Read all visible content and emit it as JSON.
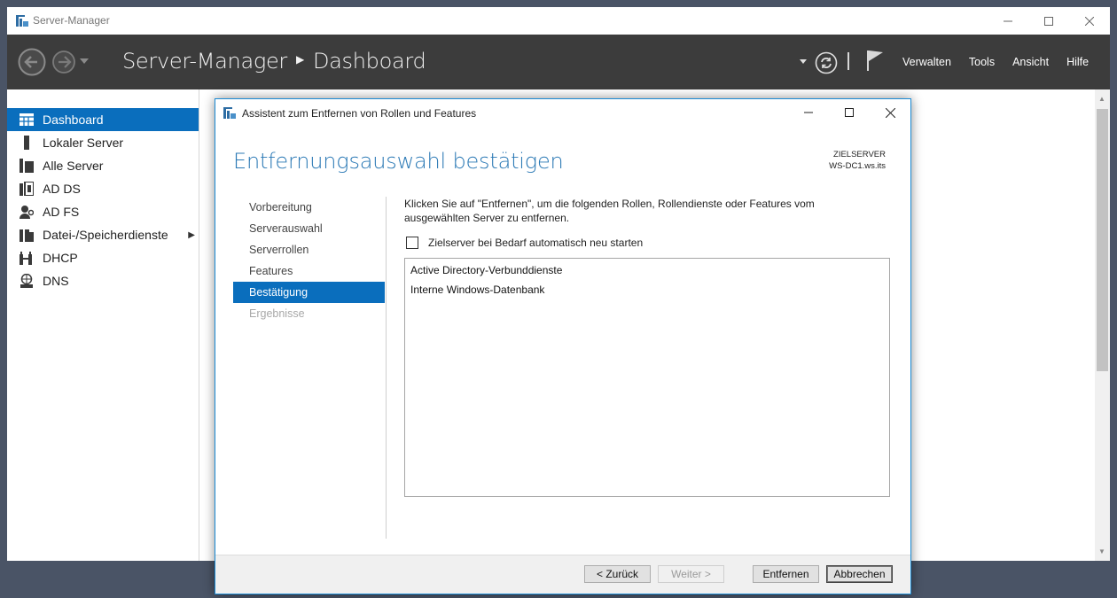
{
  "window": {
    "title": "Server-Manager",
    "controls": [
      "minimize-icon",
      "maximize-icon",
      "close-icon"
    ]
  },
  "header": {
    "breadcrumb_root": "Server-Manager",
    "breadcrumb_current": "Dashboard",
    "menus": [
      "Verwalten",
      "Tools",
      "Ansicht",
      "Hilfe"
    ]
  },
  "sidebar": {
    "items": [
      {
        "label": "Dashboard",
        "icon": "dashboard-icon",
        "active": true
      },
      {
        "label": "Lokaler Server",
        "icon": "server-icon"
      },
      {
        "label": "Alle Server",
        "icon": "servers-icon"
      },
      {
        "label": "AD DS",
        "icon": "ad-ds-icon"
      },
      {
        "label": "AD FS",
        "icon": "ad-fs-icon"
      },
      {
        "label": "Datei-/Speicherdienste",
        "icon": "storage-icon",
        "expandable": true
      },
      {
        "label": "DHCP",
        "icon": "dhcp-icon"
      },
      {
        "label": "DNS",
        "icon": "dns-icon"
      }
    ]
  },
  "dialog": {
    "title": "Assistent zum Entfernen von Rollen und Features",
    "heading": "Entfernungsauswahl bestätigen",
    "target_label": "ZIELSERVER",
    "target_value": "WS-DC1.ws.its",
    "steps": [
      {
        "label": "Vorbereitung",
        "state": "normal"
      },
      {
        "label": "Serverauswahl",
        "state": "normal"
      },
      {
        "label": "Serverrollen",
        "state": "normal"
      },
      {
        "label": "Features",
        "state": "normal"
      },
      {
        "label": "Bestätigung",
        "state": "active"
      },
      {
        "label": "Ergebnisse",
        "state": "disabled"
      }
    ],
    "description": "Klicken Sie auf \"Entfernen\", um die folgenden Rollen, Rollendienste oder Features vom ausgewählten Server zu entfernen.",
    "checkbox_label": "Zielserver bei Bedarf automatisch neu starten",
    "checkbox_checked": false,
    "list_items": [
      "Active Directory-Verbunddienste",
      "Interne Windows-Datenbank"
    ],
    "buttons": {
      "back": "< Zurück",
      "next": "Weiter >",
      "remove": "Entfernen",
      "cancel": "Abbrechen"
    }
  },
  "colors": {
    "accent": "#0a6ebd",
    "header_bg": "#3c3c3c",
    "heading": "#2b79b5"
  }
}
